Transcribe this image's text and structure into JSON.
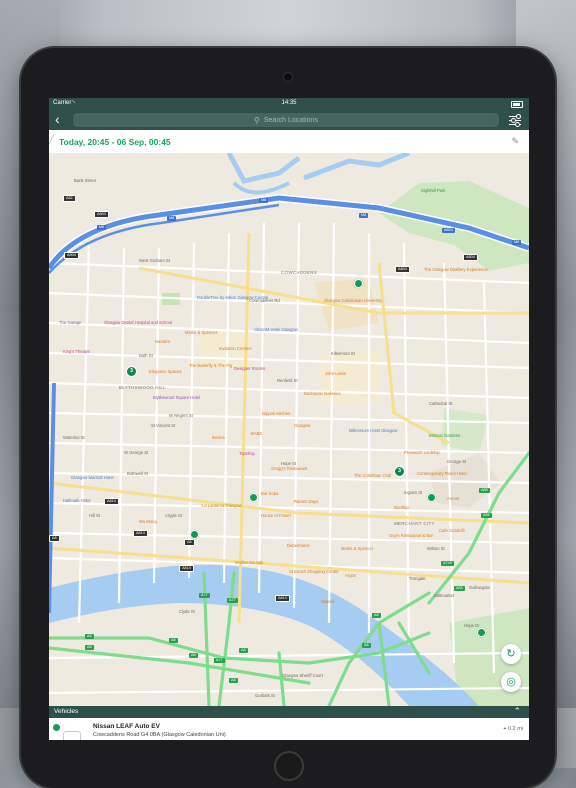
{
  "status_bar": {
    "carrier": "Carrier",
    "time": "14:35"
  },
  "nav": {
    "search_placeholder": "Search Locations"
  },
  "date_range": "Today, 20:45 - 06 Sep, 00:45",
  "map": {
    "areas": [
      "COWCADDENS",
      "BLYTHSWOOD HILL",
      "MERCHANT CITY"
    ],
    "roads": [
      "M8",
      "M8",
      "M8",
      "M8",
      "M8",
      "A804",
      "A804",
      "A804",
      "A82",
      "A814",
      "A814",
      "A814",
      "A8",
      "A8",
      "A8",
      "A8",
      "A8",
      "A8",
      "A8",
      "A77",
      "A77",
      "A77",
      "A749",
      "A89",
      "A89",
      "A89",
      "A814",
      "A8",
      "A8"
    ],
    "places": [
      {
        "name": "Sighthill Park",
        "color": "green"
      },
      {
        "name": "Cowcaddens",
        "color": "gray"
      },
      {
        "name": "Glasgow Caledonian University",
        "color": "orange"
      },
      {
        "name": "The Glasgow Distillery Experience",
        "color": "orange"
      },
      {
        "name": "The Garage",
        "color": "purple"
      },
      {
        "name": "Glasgow Dental Hospital and School",
        "color": "pink"
      },
      {
        "name": "King's Theatre",
        "color": "pink"
      },
      {
        "name": "DoubleTree by Hilton Glasgow Central",
        "color": "blue"
      },
      {
        "name": "Marks & Spencer",
        "color": "orange"
      },
      {
        "name": "citizenM Hotel Glasgow",
        "color": "blue"
      },
      {
        "name": "Nando's",
        "color": "orange"
      },
      {
        "name": "Invitation Centres",
        "color": "orange"
      },
      {
        "name": "The Butterfly & The Pig",
        "color": "orange"
      },
      {
        "name": "Designer Rooms",
        "color": "pink"
      },
      {
        "name": "Elegance Spaces",
        "color": "orange"
      },
      {
        "name": "John Lewis",
        "color": "orange"
      },
      {
        "name": "Buchanan Galleries",
        "color": "orange"
      },
      {
        "name": "Blythswood Square Hotel",
        "color": "purple"
      },
      {
        "name": "Nippon Kitchen",
        "color": "orange"
      },
      {
        "name": "Iberica",
        "color": "orange"
      },
      {
        "name": "BABS",
        "color": "orange"
      },
      {
        "name": "Glasgow",
        "color": "orange"
      },
      {
        "name": "Millennium Hotel Glasgow",
        "color": "blue"
      },
      {
        "name": "Topshop",
        "color": "pink"
      },
      {
        "name": "Botanic Gardens",
        "color": "green"
      },
      {
        "name": "Provand's Lordship",
        "color": "orange"
      },
      {
        "name": "Glasgow Marriott Hotel",
        "color": "blue"
      },
      {
        "name": "Hallmark Hotel",
        "color": "blue"
      },
      {
        "name": "Gregg's Restaurant",
        "color": "orange"
      },
      {
        "name": "The Corinthian Club",
        "color": "orange"
      },
      {
        "name": "Contemporary Room Hotel",
        "color": "orange"
      },
      {
        "name": "Amore",
        "color": "orange"
      },
      {
        "name": "Bar Soba",
        "color": "orange"
      },
      {
        "name": "La Lanterna Glasgow",
        "color": "orange"
      },
      {
        "name": "House of Fraser",
        "color": "orange"
      },
      {
        "name": "Wu Mong",
        "color": "orange"
      },
      {
        "name": "Rooftop",
        "color": "orange"
      },
      {
        "name": "Cafe Gandolfi",
        "color": "orange"
      },
      {
        "name": "Guy's Restaurant & Bar",
        "color": "orange"
      },
      {
        "name": "Debenhams",
        "color": "orange"
      },
      {
        "name": "Marks & Spencer",
        "color": "orange"
      },
      {
        "name": "Mother Sounds",
        "color": "orange"
      },
      {
        "name": "St Enoch Shopping Centre",
        "color": "orange"
      },
      {
        "name": "Argos",
        "color": "orange"
      },
      {
        "name": "Slaters",
        "color": "orange"
      },
      {
        "name": "Glasgow Sheriff Court",
        "color": "gray"
      },
      {
        "name": "Ramen Days",
        "color": "orange"
      },
      {
        "name": "Bank Street",
        "color": "gray"
      },
      {
        "name": "Olive Lane Hotel",
        "color": "blue"
      }
    ],
    "streets": [
      "West Graham St",
      "Cowcaddens Rd",
      "Bath St",
      "W Regent St",
      "St Vincent St",
      "W George St",
      "Bothwell St",
      "Argyle St",
      "Clyde St",
      "Waterloo St",
      "Cathedral St",
      "George St",
      "Ingram St",
      "Wilson St",
      "Killermont St",
      "Renfield St",
      "Hope St",
      "Hill St",
      "Trongate",
      "Gallowgate",
      "Gorbals St",
      "Saltmarket",
      "Hope Dr"
    ],
    "clusters": [
      "3",
      "3"
    ]
  },
  "vehicles_sheet": {
    "title": "Vehicles",
    "vehicle_name": "Nissan LEAF Auto EV",
    "vehicle_address": "Cowcaddens Road G4 0BA (Glasgow Caledonian Uni)",
    "distance": "0.2 mi"
  },
  "colors": {
    "accent": "#16a85a",
    "navbar": "#2f4f4a",
    "motorway": "#5b8ee6",
    "a_road_green": "#7edc8c"
  }
}
